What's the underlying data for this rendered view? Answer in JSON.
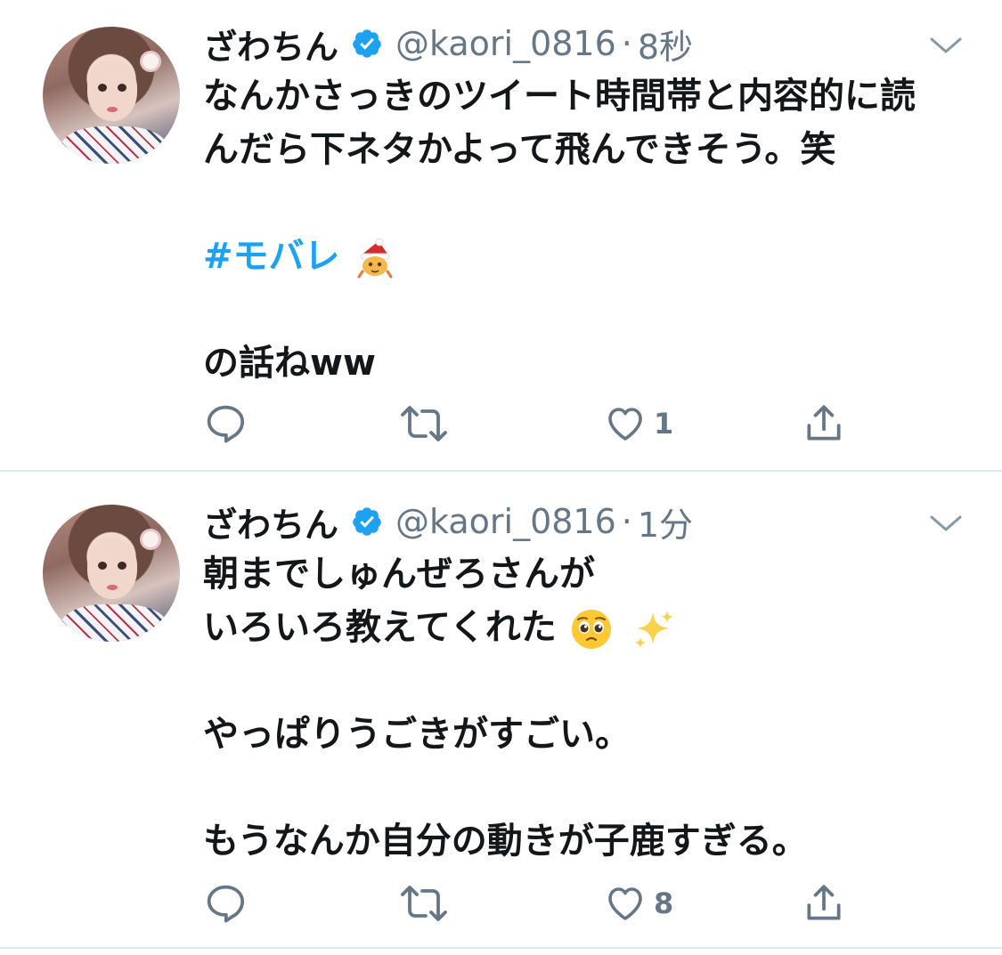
{
  "tweets": [
    {
      "author": {
        "name": "ざわちん",
        "handle": "@kaori_0816",
        "verified": true
      },
      "separator": "·",
      "time": "8秒",
      "text_lines": [
        "なんかさっきのツイート時間帯と内容的に読",
        "んだら下ネタかよって飛んできそう。笑",
        "",
        "#モバレ",
        "",
        "の話ねww"
      ],
      "hashtag": "#モバレ",
      "hashtag_emoji": "santa-character-icon",
      "actions": {
        "reply_count": "",
        "retweet_count": "",
        "like_count": "1"
      }
    },
    {
      "author": {
        "name": "ざわちん",
        "handle": "@kaori_0816",
        "verified": true
      },
      "separator": "·",
      "time": "1分",
      "text_lines": [
        "朝までしゅんぜろさんが",
        "いろいろ教えてくれた",
        "",
        "やっぱりうごきがすごい。",
        "",
        "もうなんか自分の動きが子鹿すぎる。"
      ],
      "line2_emojis": [
        "pleading-face-icon",
        "sparkles-icon"
      ],
      "actions": {
        "reply_count": "",
        "retweet_count": "",
        "like_count": "8"
      }
    }
  ],
  "colors": {
    "text": "#14171a",
    "secondary": "#657786",
    "accent": "#1da1f2",
    "divider": "#e1e8ed",
    "verified": "#1da1f2"
  }
}
